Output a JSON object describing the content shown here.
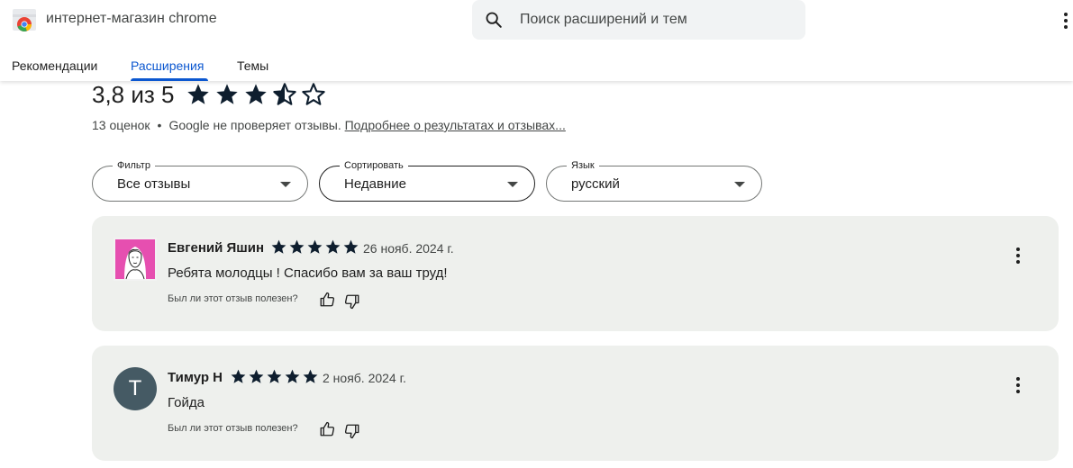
{
  "header": {
    "store_title": "интернет-магазин chrome",
    "search_placeholder": "Поиск расширений и тем",
    "tabs": [
      {
        "label": "Рекомендации",
        "active": false
      },
      {
        "label": "Расширения",
        "active": true
      },
      {
        "label": "Темы",
        "active": false
      }
    ],
    "accent_color": "#0b57d0"
  },
  "summary": {
    "rating_text": "3,8 из 5",
    "rating_value": 3.8,
    "rating_max": 5,
    "count_text": "13 оценок",
    "separator": "•",
    "notice": "Google не проверяет отзывы.",
    "learn_more": "Подробнее о результатах и отзывах..."
  },
  "filters": {
    "filter": {
      "label": "Фильтр",
      "value": "Все отзывы"
    },
    "sort": {
      "label": "Сортировать",
      "value": "Недавние"
    },
    "language": {
      "label": "Язык",
      "value": "русский"
    }
  },
  "reviews": [
    {
      "author": "Евгений Яшин",
      "stars": 5,
      "date": "26 нояб. 2024 г.",
      "text": "Ребята молодцы ! Спасибо вам за ваш труд!",
      "helpful_prompt": "Был ли этот отзыв полезен?",
      "avatar": "photo"
    },
    {
      "author": "Тимур Н",
      "stars": 5,
      "date": "2 нояб. 2024 г.",
      "text": "Гойда",
      "helpful_prompt": "Был ли этот отзыв полезен?",
      "avatar_letter": "T",
      "avatar_color": "#455a64"
    }
  ],
  "icons": {
    "logo": "chrome-web-store-icon",
    "search": "search-icon",
    "menu": "more-vert-icon",
    "star": "star-icon",
    "thumb_up": "thumb-up-icon",
    "thumb_down": "thumb-down-icon",
    "dropdown": "arrow-drop-down-icon"
  }
}
